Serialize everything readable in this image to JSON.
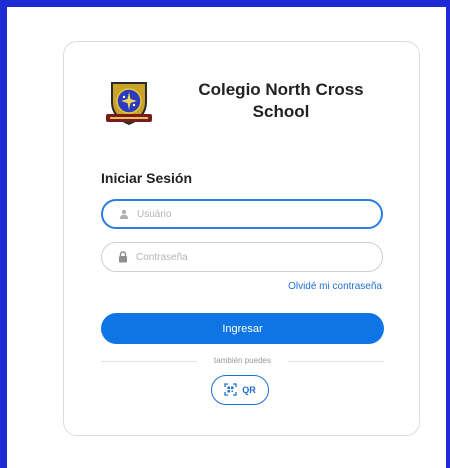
{
  "school": {
    "name_line1": "Colegio North Cross",
    "name_line2": "School",
    "logo_icon": "school-crest-icon"
  },
  "login": {
    "title": "Iniciar Sesión",
    "username_placeholder": "Usuário",
    "password_placeholder": "Contraseña",
    "forgot_link": "Olvidé mi contraseña",
    "submit_label": "Ingresar",
    "alt_text": "también puedes",
    "qr_label": "QR"
  },
  "colors": {
    "frame_border": "#1e2bd6",
    "primary": "#0f74e4",
    "link": "#1f6fd1"
  }
}
